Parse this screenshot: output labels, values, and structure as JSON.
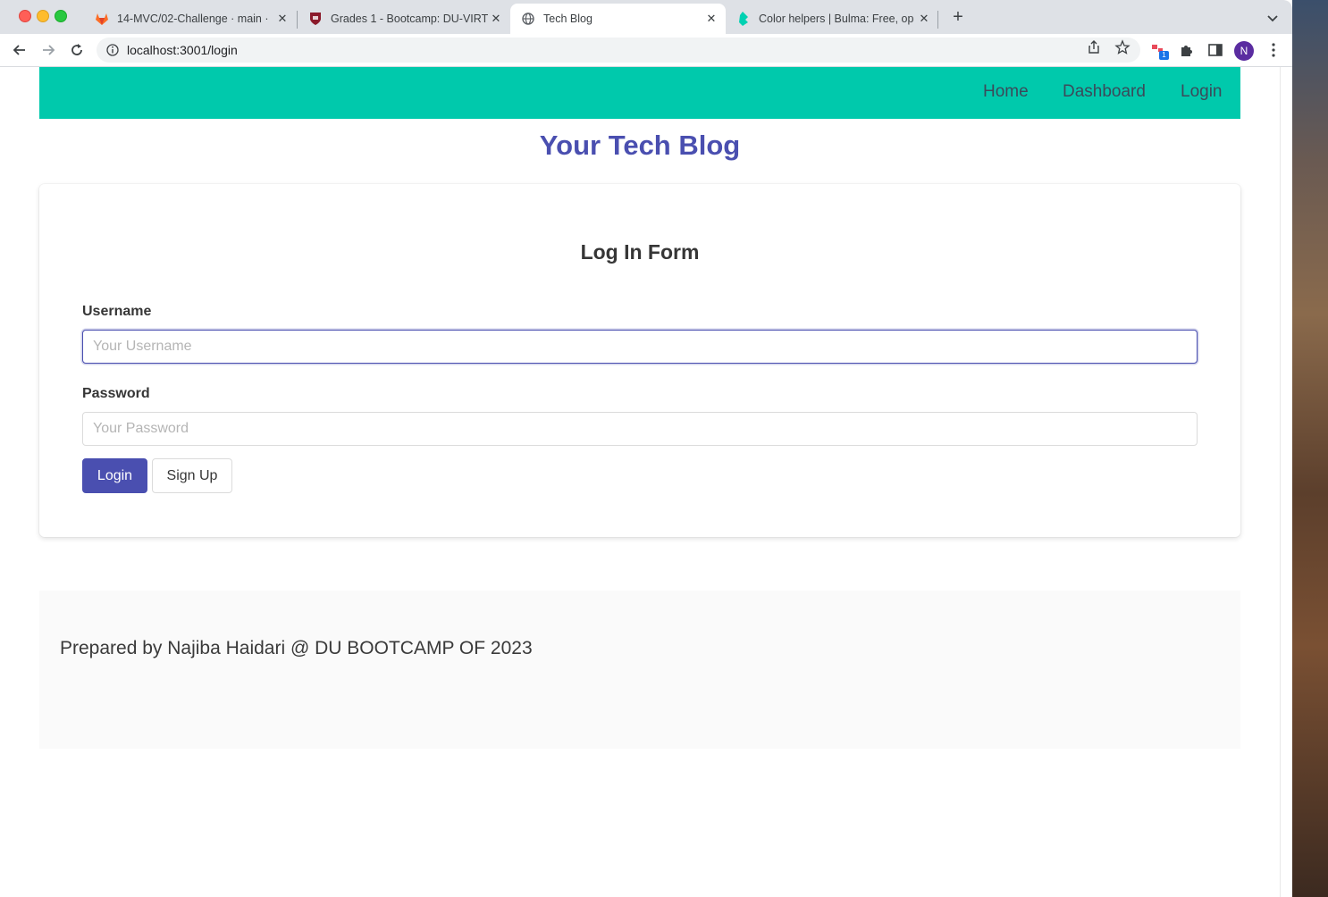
{
  "browser": {
    "tabs": [
      {
        "title": "14-MVC/02-Challenge · main ·",
        "icon": "gitlab-icon",
        "active": false
      },
      {
        "title": "Grades 1 - Bootcamp: DU-VIRT",
        "icon": "shield-crest-icon",
        "active": false
      },
      {
        "title": "Tech Blog",
        "icon": "globe-icon",
        "active": true
      },
      {
        "title": "Color helpers | Bulma: Free, op",
        "icon": "bulma-icon",
        "active": false
      }
    ],
    "new_tab_label": "+",
    "url": "localhost:3001/login",
    "extension_badge": "1",
    "profile_initial": "N"
  },
  "nav": {
    "links": [
      "Home",
      "Dashboard",
      "Login"
    ]
  },
  "site": {
    "title": "Your Tech Blog"
  },
  "form": {
    "title": "Log In Form",
    "username_label": "Username",
    "username_placeholder": "Your Username",
    "password_label": "Password",
    "password_placeholder": "Your Password",
    "login_button": "Login",
    "signup_button": "Sign Up"
  },
  "footer": {
    "text": "Prepared by Najiba Haidari @ DU BOOTCAMP OF 2023"
  },
  "colors": {
    "navbar": "#00c9ac",
    "primary": "#4a4fb0",
    "footer_bg": "#fafafa"
  }
}
